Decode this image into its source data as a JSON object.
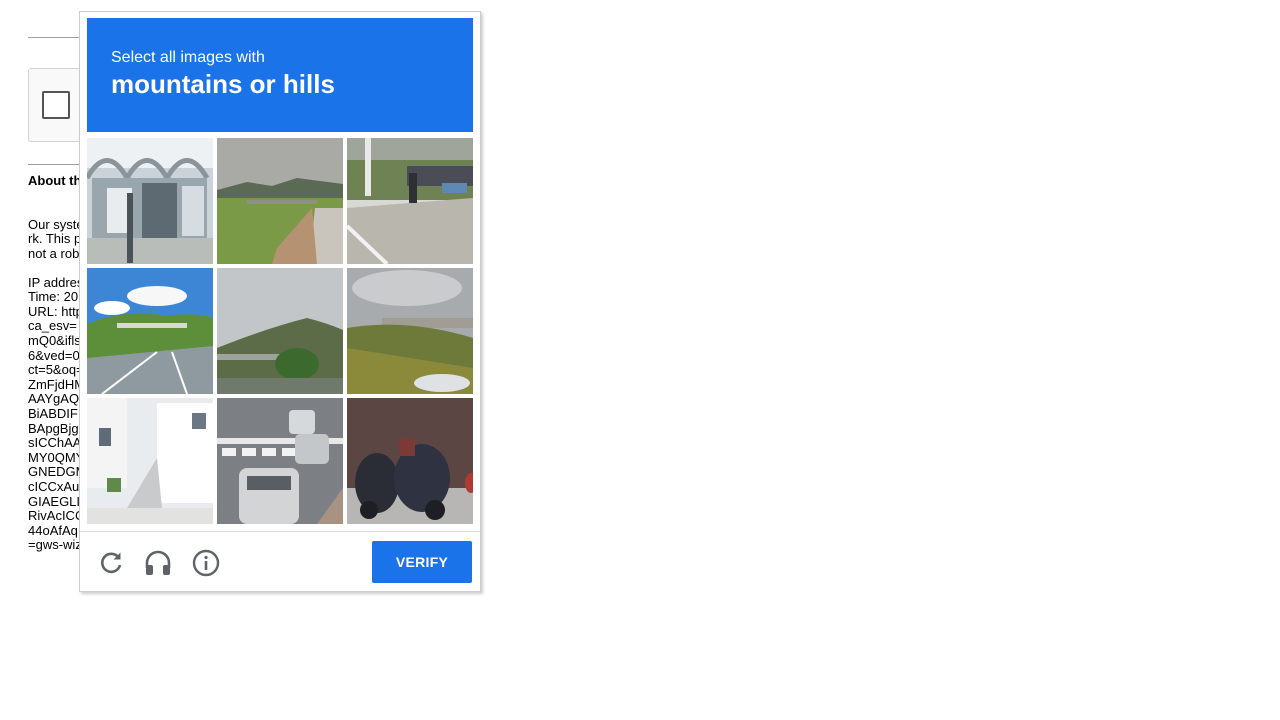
{
  "background": {
    "heading": "About th",
    "paragraph_lines": [
      "Our syste",
      "rk. This p",
      "not a rob"
    ],
    "details_lines": [
      "IP addres",
      "Time: 20",
      "URL: http",
      "ca_esv=",
      "mQ0&ifls",
      "6&ved=0",
      "ct=5&oq=",
      "ZmFjdHM",
      "AAYgAQ",
      "BiABDIF",
      "BApgBjg",
      "sICChAA",
      "MY0QMY",
      "GNEDGM",
      "cICCxAu",
      "GIAEGLI",
      "RivAcICC",
      "44oAfAq",
      "=gws-wiz"
    ]
  },
  "challenge": {
    "prompt_line": "Select all images with",
    "target": "mountains or hills",
    "tiles": [
      {
        "name": "tile-bus-shelter"
      },
      {
        "name": "tile-road-bridge-hills"
      },
      {
        "name": "tile-sidewalk-motorbikes"
      },
      {
        "name": "tile-highway-green-hills"
      },
      {
        "name": "tile-overpass-hill"
      },
      {
        "name": "tile-grassy-embankment"
      },
      {
        "name": "tile-white-building"
      },
      {
        "name": "tile-crosswalk-cars"
      },
      {
        "name": "tile-parked-scooters"
      }
    ],
    "verify_label": "VERIFY",
    "controls": {
      "reload": "reload-icon",
      "audio": "headphones-icon",
      "info": "info-icon"
    },
    "colors": {
      "header": "#1a73e8",
      "button": "#1a73e8",
      "icon": "#5f6368"
    }
  }
}
